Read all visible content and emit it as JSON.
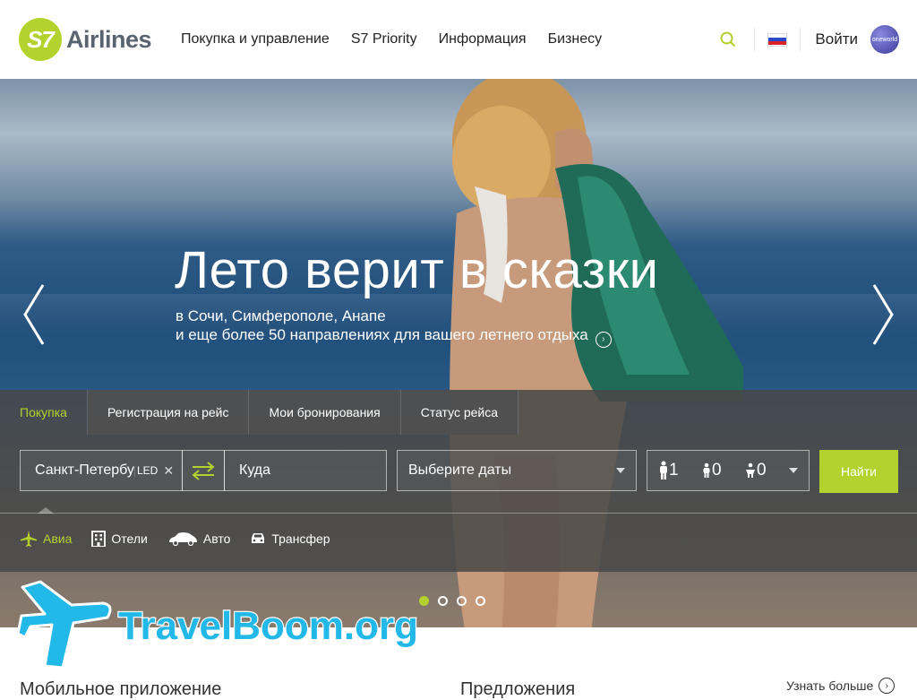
{
  "header": {
    "logo_mark": "S7",
    "logo_text": "Airlines",
    "nav": [
      "Покупка и управление",
      "S7 Priority",
      "Информация",
      "Бизнесу"
    ],
    "login": "Войти",
    "alliance": "oneworld"
  },
  "hero": {
    "title": "Лето верит в сказки",
    "subtitle_line1": "в Сочи, Симферополе, Анапе",
    "subtitle_line2": "и еще более 50 направлениях для вашего летнего отдыха"
  },
  "booking": {
    "tabs": [
      "Покупка",
      "Регистрация на рейс",
      "Мои бронирования",
      "Статус рейса"
    ],
    "active_tab": "Покупка",
    "from_value": "Санкт-Петербург",
    "from_code": "LED",
    "to_placeholder": "Куда",
    "dates_placeholder": "Выберите даты",
    "pax_adults": "1",
    "pax_children": "0",
    "pax_infants": "0",
    "find_button": "Найти",
    "services": [
      "Авиа",
      "Отели",
      "Авто",
      "Трансфер"
    ]
  },
  "slider": {
    "count": 4,
    "active_index": 0
  },
  "watermark": "TravelBoom.org",
  "bottom": {
    "mobile_title": "Мобильное приложение",
    "offers_title": "Предложения",
    "learn_more": "Узнать больше"
  },
  "colors": {
    "accent": "#b4d22e",
    "panel": "#484848"
  }
}
